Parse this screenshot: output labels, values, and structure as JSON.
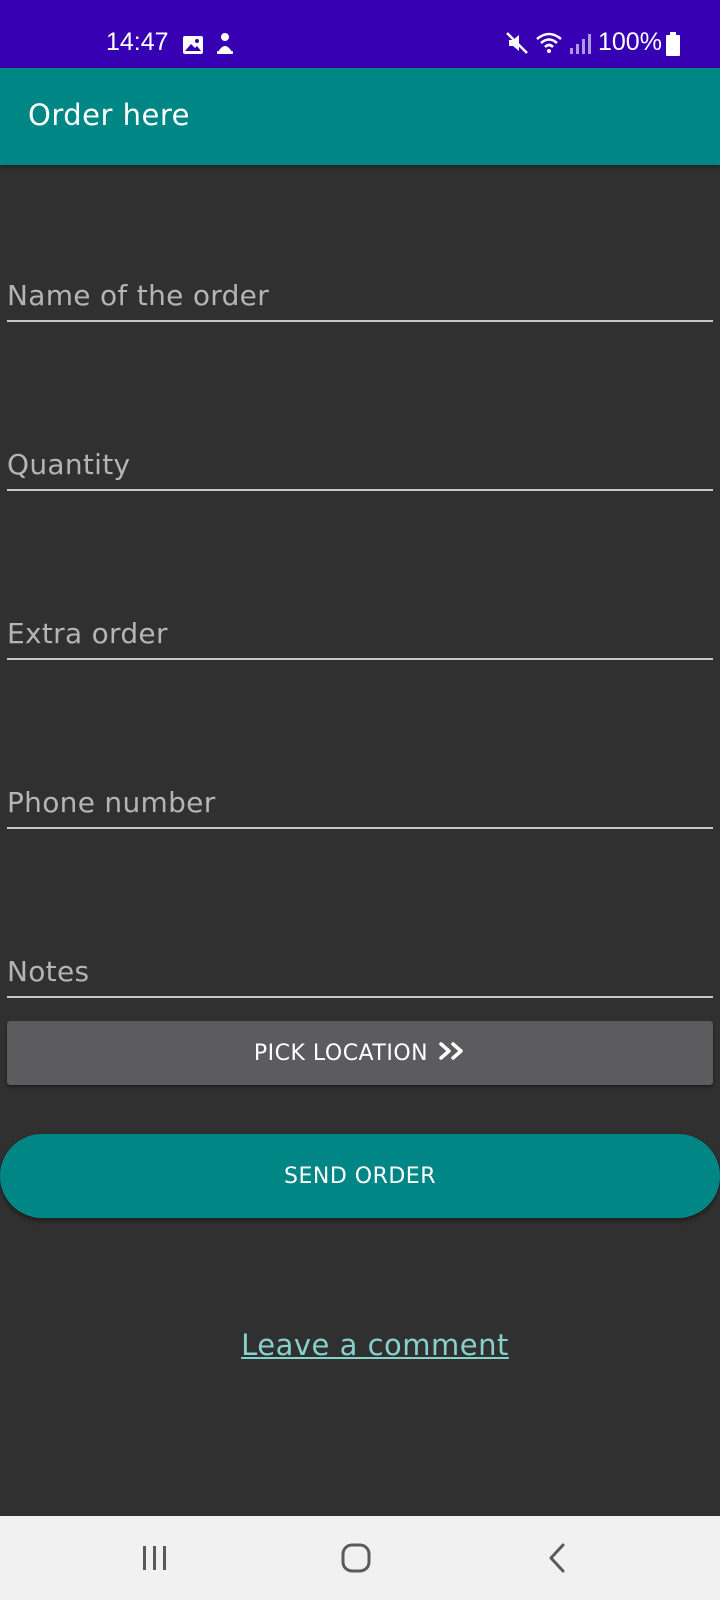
{
  "status_bar": {
    "time": "14:47",
    "battery": "100%",
    "icons": [
      "gallery-icon",
      "notification-icon",
      "mute-icon",
      "wifi-icon",
      "signal-icon",
      "battery-icon"
    ],
    "background": "#3700B3"
  },
  "app_bar": {
    "title": "Order here",
    "background": "#008785"
  },
  "form": {
    "fields": [
      {
        "name": "order-name-field",
        "placeholder": "Name of the order",
        "value": ""
      },
      {
        "name": "quantity-field",
        "placeholder": "Quantity",
        "value": ""
      },
      {
        "name": "extra-order-field",
        "placeholder": "Extra order",
        "value": ""
      },
      {
        "name": "phone-number-field",
        "placeholder": "Phone number",
        "value": ""
      },
      {
        "name": "notes-field",
        "placeholder": "Notes",
        "value": ""
      }
    ],
    "pick_location_label": "PICK LOCATION",
    "pick_location_icon": "double-chevron-right-icon",
    "send_order_label": "SEND ORDER",
    "comment_link_label": "Leave a comment"
  },
  "nav_bar": {
    "items": [
      "recents-icon",
      "home-icon",
      "back-icon"
    ]
  },
  "colors": {
    "accent": "#008785",
    "background": "#303030",
    "link": "#86d1cb",
    "secondary_button": "#5c5c5e"
  }
}
